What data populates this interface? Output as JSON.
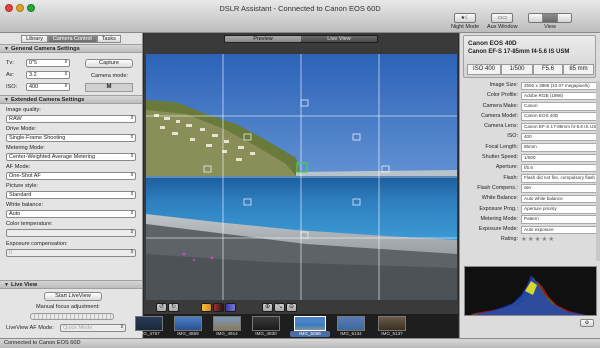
{
  "window": {
    "title": "DSLR Assistant - Connected to Canon EOS 60D"
  },
  "toolbar": {
    "night_mode": "Night Mode",
    "aux_window": "Aux Window",
    "view": "View"
  },
  "left_panel": {
    "tabs": [
      "Library",
      "Camera Control",
      "Tasks"
    ],
    "general": {
      "title": "General Camera Settings",
      "tv_label": "Tv:",
      "tv_value": "0\"5",
      "av_label": "Av:",
      "av_value": "3.2",
      "iso_label": "ISO:",
      "iso_value": "400",
      "capture_button": "Capture",
      "camera_mode_label": "Camera mode:",
      "camera_mode_value": "M"
    },
    "extended": {
      "title": "Extended Camera Settings",
      "image_quality_label": "Image quality:",
      "image_quality_value": "RAW",
      "drive_mode_label": "Drive Mode:",
      "drive_mode_value": "Single-Frame Shooting",
      "metering_label": "Metering Mode:",
      "metering_value": "Center-Weighted Average Metering",
      "af_mode_label": "AF Mode:",
      "af_mode_value": "One-Shot AF",
      "picture_style_label": "Picture style:",
      "picture_style_value": "Standard",
      "white_balance_label": "White balance:",
      "white_balance_value": "Auto",
      "color_temp_label": "Color temperature:",
      "exposure_comp_label": "Exposure compensation:",
      "exposure_comp_value": "0"
    },
    "live_view": {
      "title": "Live View",
      "start_button": "Start LiveView",
      "manual_focus_label": "Manual focus adjustment:",
      "af_mode_label": "LiveView AF Mode:",
      "af_mode_value": "Quick Mode"
    }
  },
  "center": {
    "tabs": [
      "Preview",
      "Live View"
    ],
    "active_tab": "Preview",
    "tools": {
      "rotate": [
        "↺",
        "↻"
      ],
      "zoom": [
        "⊕",
        "⤡",
        "⊖"
      ]
    },
    "thumbnails": [
      {
        "name": "IMG_4767"
      },
      {
        "name": "IMG_4859"
      },
      {
        "name": "IMG_4914"
      },
      {
        "name": "IMG_4930"
      },
      {
        "name": "IMG_5089",
        "selected": true
      },
      {
        "name": "IMG_5134"
      },
      {
        "name": "IMG_5137"
      }
    ]
  },
  "right_panel": {
    "camera": "Canon EOS 40D",
    "lens": "Canon EF-S 17-85mm f4-5.6 IS USM",
    "exposure": [
      "ISO 400",
      "1/500",
      "F5.6",
      "85 mm"
    ],
    "metadata": [
      {
        "key": "Image Size:",
        "value": "2592 x 3888 (10.07 megapixels)"
      },
      {
        "key": "Color Profile:",
        "value": "Adobe RGB (1998)"
      },
      {
        "key": "Camera Make:",
        "value": "Canon"
      },
      {
        "key": "Camera Model:",
        "value": "Canon EOS 40D"
      },
      {
        "key": "Camera Lens:",
        "value": "Canon EF-S 17-85mm f4-5.6 IS USM"
      },
      {
        "key": "ISO:",
        "value": "400"
      },
      {
        "key": "Focal Length:",
        "value": "85mm"
      },
      {
        "key": "Shutter Speed:",
        "value": "1/500"
      },
      {
        "key": "Aperture:",
        "value": "f/5.6"
      },
      {
        "key": "Flash:",
        "value": "Flash did not fire, compulsory flash mode"
      },
      {
        "key": "Flash Compens.:",
        "value": "0ev"
      },
      {
        "key": "White Balance:",
        "value": "Auto white balance"
      },
      {
        "key": "Exposure Prog.:",
        "value": "Aperture priority"
      },
      {
        "key": "Metering Mode:",
        "value": "Pattern"
      },
      {
        "key": "Exposure Mode:",
        "value": "Auto exposure"
      },
      {
        "key": "Rating:",
        "value": "★★★★★"
      }
    ]
  },
  "status": {
    "text": "Connected to Canon EOS 60D"
  }
}
